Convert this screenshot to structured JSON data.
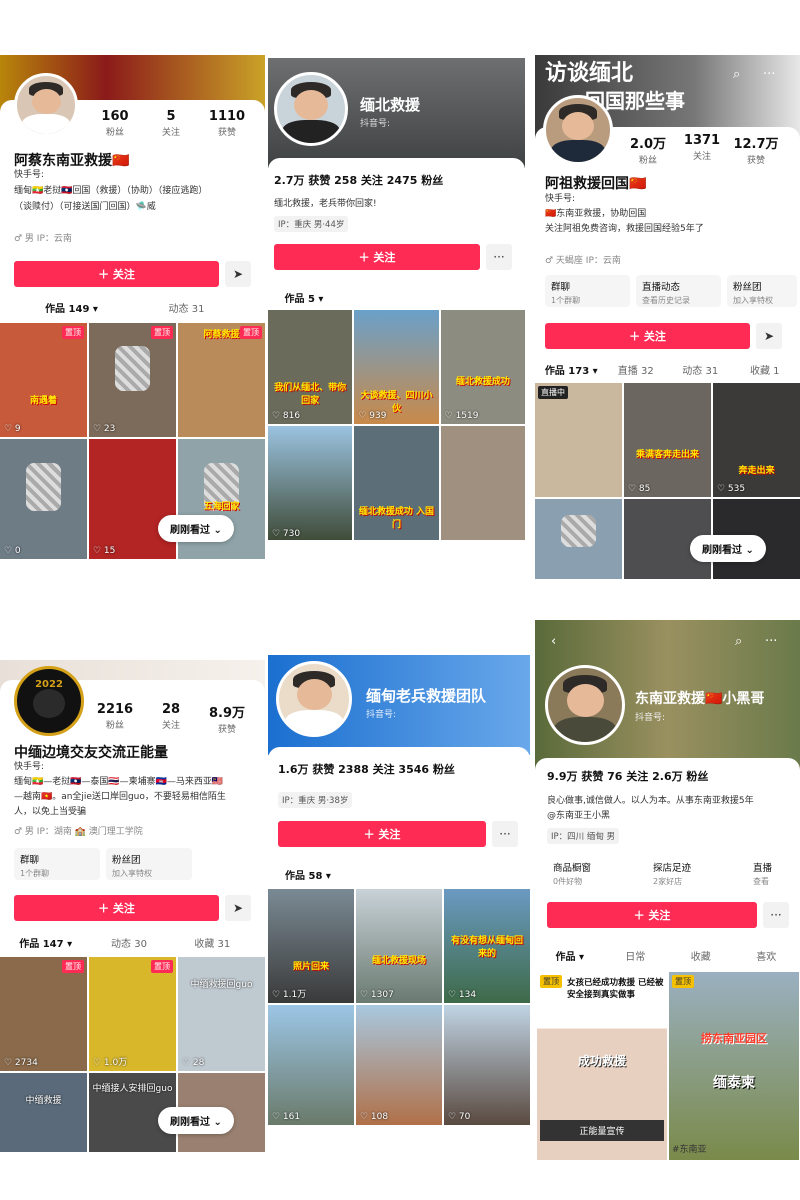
{
  "common": {
    "follow": "＋ 关注",
    "share": "➤",
    "more": "···",
    "watch": "刷刚看过 ⌄",
    "pin": "置顶"
  },
  "p1": {
    "name": "阿蔡东南亚救援🇨🇳",
    "stats": [
      {
        "n": "160",
        "l": "粉丝"
      },
      {
        "n": "5",
        "l": "关注"
      },
      {
        "n": "1110",
        "l": "获赞"
      }
    ],
    "id_label": "快手号:",
    "bio1": "缅甸🇲🇲老挝🇱🇦回国（救援）（协助）（接应逃跑）",
    "bio2": "（谈赎付）（可接送国门回国）🛸威",
    "tags": "♂ 男    IP：云南",
    "tabs": [
      "作品 149 ▾",
      "动态 31"
    ],
    "videos": [
      {
        "like": "♡ 9",
        "cap": "南遇着"
      },
      {
        "like": "♡ 23",
        "cap": ""
      },
      {
        "like": "",
        "cap": "阿蔡救援"
      },
      {
        "like": "♡ 0",
        "cap": ""
      },
      {
        "like": "♡ 15",
        "cap": ""
      },
      {
        "like": "",
        "cap": "五海回家"
      }
    ]
  },
  "p2": {
    "cover_title": "缅北救援",
    "cover_sub": "抖音号:",
    "stats": "2.7万 获赞   258 关注   2475 粉丝",
    "bio": "缅北救援，老兵带你回家!",
    "tags": "IP：重庆    男·44岁",
    "tab": "作品 5 ▾",
    "videos": [
      {
        "like": "♡ 816",
        "cap": "我们从缅北、带你回家"
      },
      {
        "like": "♡ 939",
        "cap": "大谈救援、四川小伙"
      },
      {
        "like": "♡ 1519",
        "cap": "缅北救援成功"
      },
      {
        "like": "♡ 730",
        "cap": ""
      },
      {
        "like": "",
        "cap": "缅北救援成功 入国门"
      }
    ]
  },
  "p3": {
    "cover_title1": "访谈缅北",
    "cover_title2": "回国那些事",
    "name": "阿祖救援回国🇨🇳",
    "stats": [
      {
        "n": "2.0万",
        "l": "粉丝"
      },
      {
        "n": "1371",
        "l": "关注"
      },
      {
        "n": "12.7万",
        "l": "获赞"
      }
    ],
    "id_label": "快手号:",
    "bio1": "🇨🇳东南亚救援，协助回国",
    "bio2": "关注阿祖免费咨询，救援回国经验5年了",
    "tags": "♂ 天蝎座    IP：云南",
    "cards": [
      {
        "t": "群聊",
        "s": "1个群聊"
      },
      {
        "t": "直播动态",
        "s": "查看历史记录"
      },
      {
        "t": "粉丝团",
        "s": "加入享特权"
      }
    ],
    "tabs": [
      "作品 173 ▾",
      "直播 32",
      "动态 31",
      "收藏 1"
    ],
    "videos": [
      {
        "like": "",
        "cap": "直播中"
      },
      {
        "like": "♡ 85",
        "cap": "乘满客奔走出来"
      },
      {
        "like": "♡ 535",
        "cap": "奔走出来"
      },
      {
        "like": "",
        "cap": ""
      },
      {
        "like": "",
        "cap": ""
      },
      {
        "like": "",
        "cap": ""
      }
    ]
  },
  "p4": {
    "name": "中缅边境交友交流正能量",
    "stats": [
      {
        "n": "2216",
        "l": "粉丝"
      },
      {
        "n": "28",
        "l": "关注"
      },
      {
        "n": "8.9万",
        "l": "获赞"
      }
    ],
    "badge": "2022",
    "id_label": "快手号:",
    "bio1": "缅甸🇲🇲—老挝🇱🇦—泰国🇹🇭—柬埔寨🇰🇭—马来西亚🇲🇾",
    "bio2": "—越南🇻🇳。an全jie送口岸回guo，不要轻易相信陌生",
    "bio3": "人，以免上当受骗",
    "tags": "♂ 男    IP：湖南    🏫 澳门理工学院",
    "cards": [
      {
        "t": "群聊",
        "s": "1个群聊"
      },
      {
        "t": "粉丝团",
        "s": "加入享特权"
      }
    ],
    "tabs": [
      "作品 147 ▾",
      "动态 30",
      "收藏 31"
    ],
    "videos": [
      {
        "like": "♡ 2734",
        "cap": ""
      },
      {
        "like": "♡ 1.0万",
        "cap": ""
      },
      {
        "like": "♡ 28",
        "cap": "中缅救援回guo"
      },
      {
        "like": "",
        "cap": "中缅救援"
      },
      {
        "like": "",
        "cap": "中缅接人安排回guo"
      },
      {
        "like": "",
        "cap": ""
      }
    ]
  },
  "p5": {
    "cover_title": "缅甸老兵救援团队",
    "cover_sub": "抖音号:",
    "stats": "1.6万 获赞   2388 关注   3546 粉丝",
    "tags": "IP：重庆    男·38岁",
    "tab": "作品 58 ▾",
    "videos": [
      {
        "like": "♡ 1.1万",
        "cap": "照片回来"
      },
      {
        "like": "♡ 1307",
        "cap": "缅北救援现场"
      },
      {
        "like": "♡ 134",
        "cap": "有没有想从缅甸回来的"
      },
      {
        "like": "♡ 161",
        "cap": ""
      },
      {
        "like": "♡ 108",
        "cap": ""
      },
      {
        "like": "♡ 70",
        "cap": ""
      }
    ]
  },
  "p6": {
    "cover_title": "东南亚救援🇨🇳小黑哥",
    "cover_sub": "抖音号:",
    "stats": "9.9万 获赞   76 关注   2.6万 粉丝",
    "bio1": "良心做事,诚信做人。以人为本。从事东南亚救援5年",
    "bio2": "@东南亚王小黑",
    "tags": "IP：四川    缅甸    男",
    "cards": [
      {
        "t": "商品橱窗",
        "s": "0件好物"
      },
      {
        "t": "探店足迹",
        "s": "2家好店"
      },
      {
        "t": "直播",
        "s": "查看"
      }
    ],
    "tabs": [
      "作品 ▾",
      "日常",
      "收藏",
      "喜欢"
    ],
    "videos": [
      {
        "cap": "成功救援",
        "top": "女孩已经成功救援 已经被安全接到真实做事",
        "foot": "正能量宣传"
      },
      {
        "cap": "缅泰柬",
        "top": "捞东南亚园区",
        "foot": "#东南亚"
      }
    ]
  }
}
